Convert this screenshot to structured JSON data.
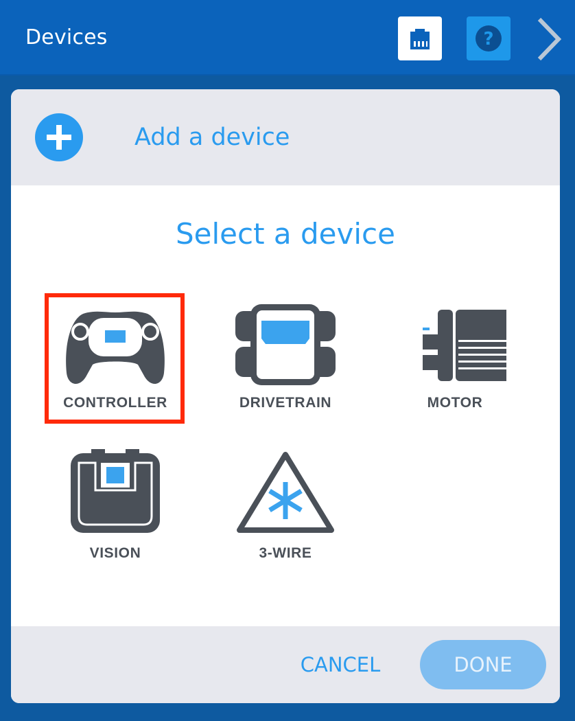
{
  "header": {
    "title": "Devices",
    "port_icon": "ports-icon",
    "help_icon": "help-icon",
    "next_icon": "chevron-right-icon"
  },
  "dialog": {
    "add_label": "Add a device",
    "add_icon": "plus-circle-icon",
    "select_title": "Select a device",
    "devices": [
      {
        "label": "CONTROLLER",
        "icon": "controller-icon",
        "selected": true
      },
      {
        "label": "DRIVETRAIN",
        "icon": "drivetrain-icon",
        "selected": false
      },
      {
        "label": "MOTOR",
        "icon": "motor-icon",
        "selected": false
      },
      {
        "label": "VISION",
        "icon": "vision-sensor-icon",
        "selected": false
      },
      {
        "label": "3-WIRE",
        "icon": "three-wire-icon",
        "selected": false
      }
    ],
    "cancel_label": "CANCEL",
    "done_label": "DONE"
  },
  "colors": {
    "header_blue": "#0b63bb",
    "accent_blue": "#2a9bef",
    "icon_dark": "#4a5058",
    "selection_red": "#ff2a0a",
    "done_disabled": "#7fbdf0"
  }
}
